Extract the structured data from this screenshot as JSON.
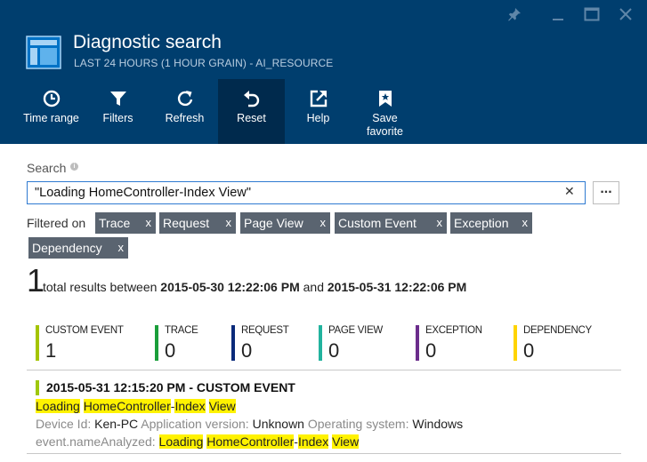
{
  "header": {
    "title": "Diagnostic search",
    "subtitle": "LAST 24 HOURS (1 HOUR GRAIN) - AI_RESOURCE",
    "commands": [
      {
        "label": "Time range",
        "icon": "clock-icon"
      },
      {
        "label": "Filters",
        "icon": "funnel-icon"
      },
      {
        "label": "Refresh",
        "icon": "refresh-icon"
      },
      {
        "label": "Reset",
        "icon": "undo-icon"
      },
      {
        "label": "Help",
        "icon": "external-link-icon"
      },
      {
        "label": "Save favorite",
        "icon": "bookmark-star-icon"
      }
    ],
    "active_command": "Reset"
  },
  "colors": {
    "header_bg": "#003e6e",
    "active_command_bg": "#002a4d",
    "tag_bg": "#5a6470",
    "highlight": "#fff200",
    "focus_border": "#2f7ad1"
  },
  "search": {
    "label": "Search",
    "value": "\"Loading HomeController-Index View\"",
    "clear_glyph": "✕",
    "more_glyph": "..."
  },
  "filters": {
    "label": "Filtered on",
    "tags": [
      "Trace",
      "Request",
      "Page View",
      "Custom Event",
      "Exception",
      "Dependency"
    ],
    "remove_glyph": "x"
  },
  "summary": {
    "count": "1",
    "prefix": "total results between",
    "start": "2015-05-30 12:22:06 PM",
    "joiner": "and",
    "end": "2015-05-31 12:22:06 PM"
  },
  "categories": [
    {
      "name": "CUSTOM EVENT",
      "count": "1",
      "color": "#a4c400"
    },
    {
      "name": "TRACE",
      "count": "0",
      "color": "#1a9e3a"
    },
    {
      "name": "REQUEST",
      "count": "0",
      "color": "#0a2a7a"
    },
    {
      "name": "PAGE VIEW",
      "count": "0",
      "color": "#22b39e"
    },
    {
      "name": "EXCEPTION",
      "count": "0",
      "color": "#6b2d8c"
    },
    {
      "name": "DEPENDENCY",
      "count": "0",
      "color": "#ffd400"
    }
  ],
  "result": {
    "title": "2015-05-31 12:15:20 PM - CUSTOM EVENT",
    "message_parts": [
      "Loading",
      "HomeController",
      "-",
      "Index",
      "View"
    ],
    "device_label": "Device Id:",
    "device_value": "Ken-PC",
    "app_label": "Application version:",
    "app_value": "Unknown",
    "os_label": "Operating system:",
    "os_value": "Windows",
    "name_label": "event.nameAnalyzed:"
  }
}
